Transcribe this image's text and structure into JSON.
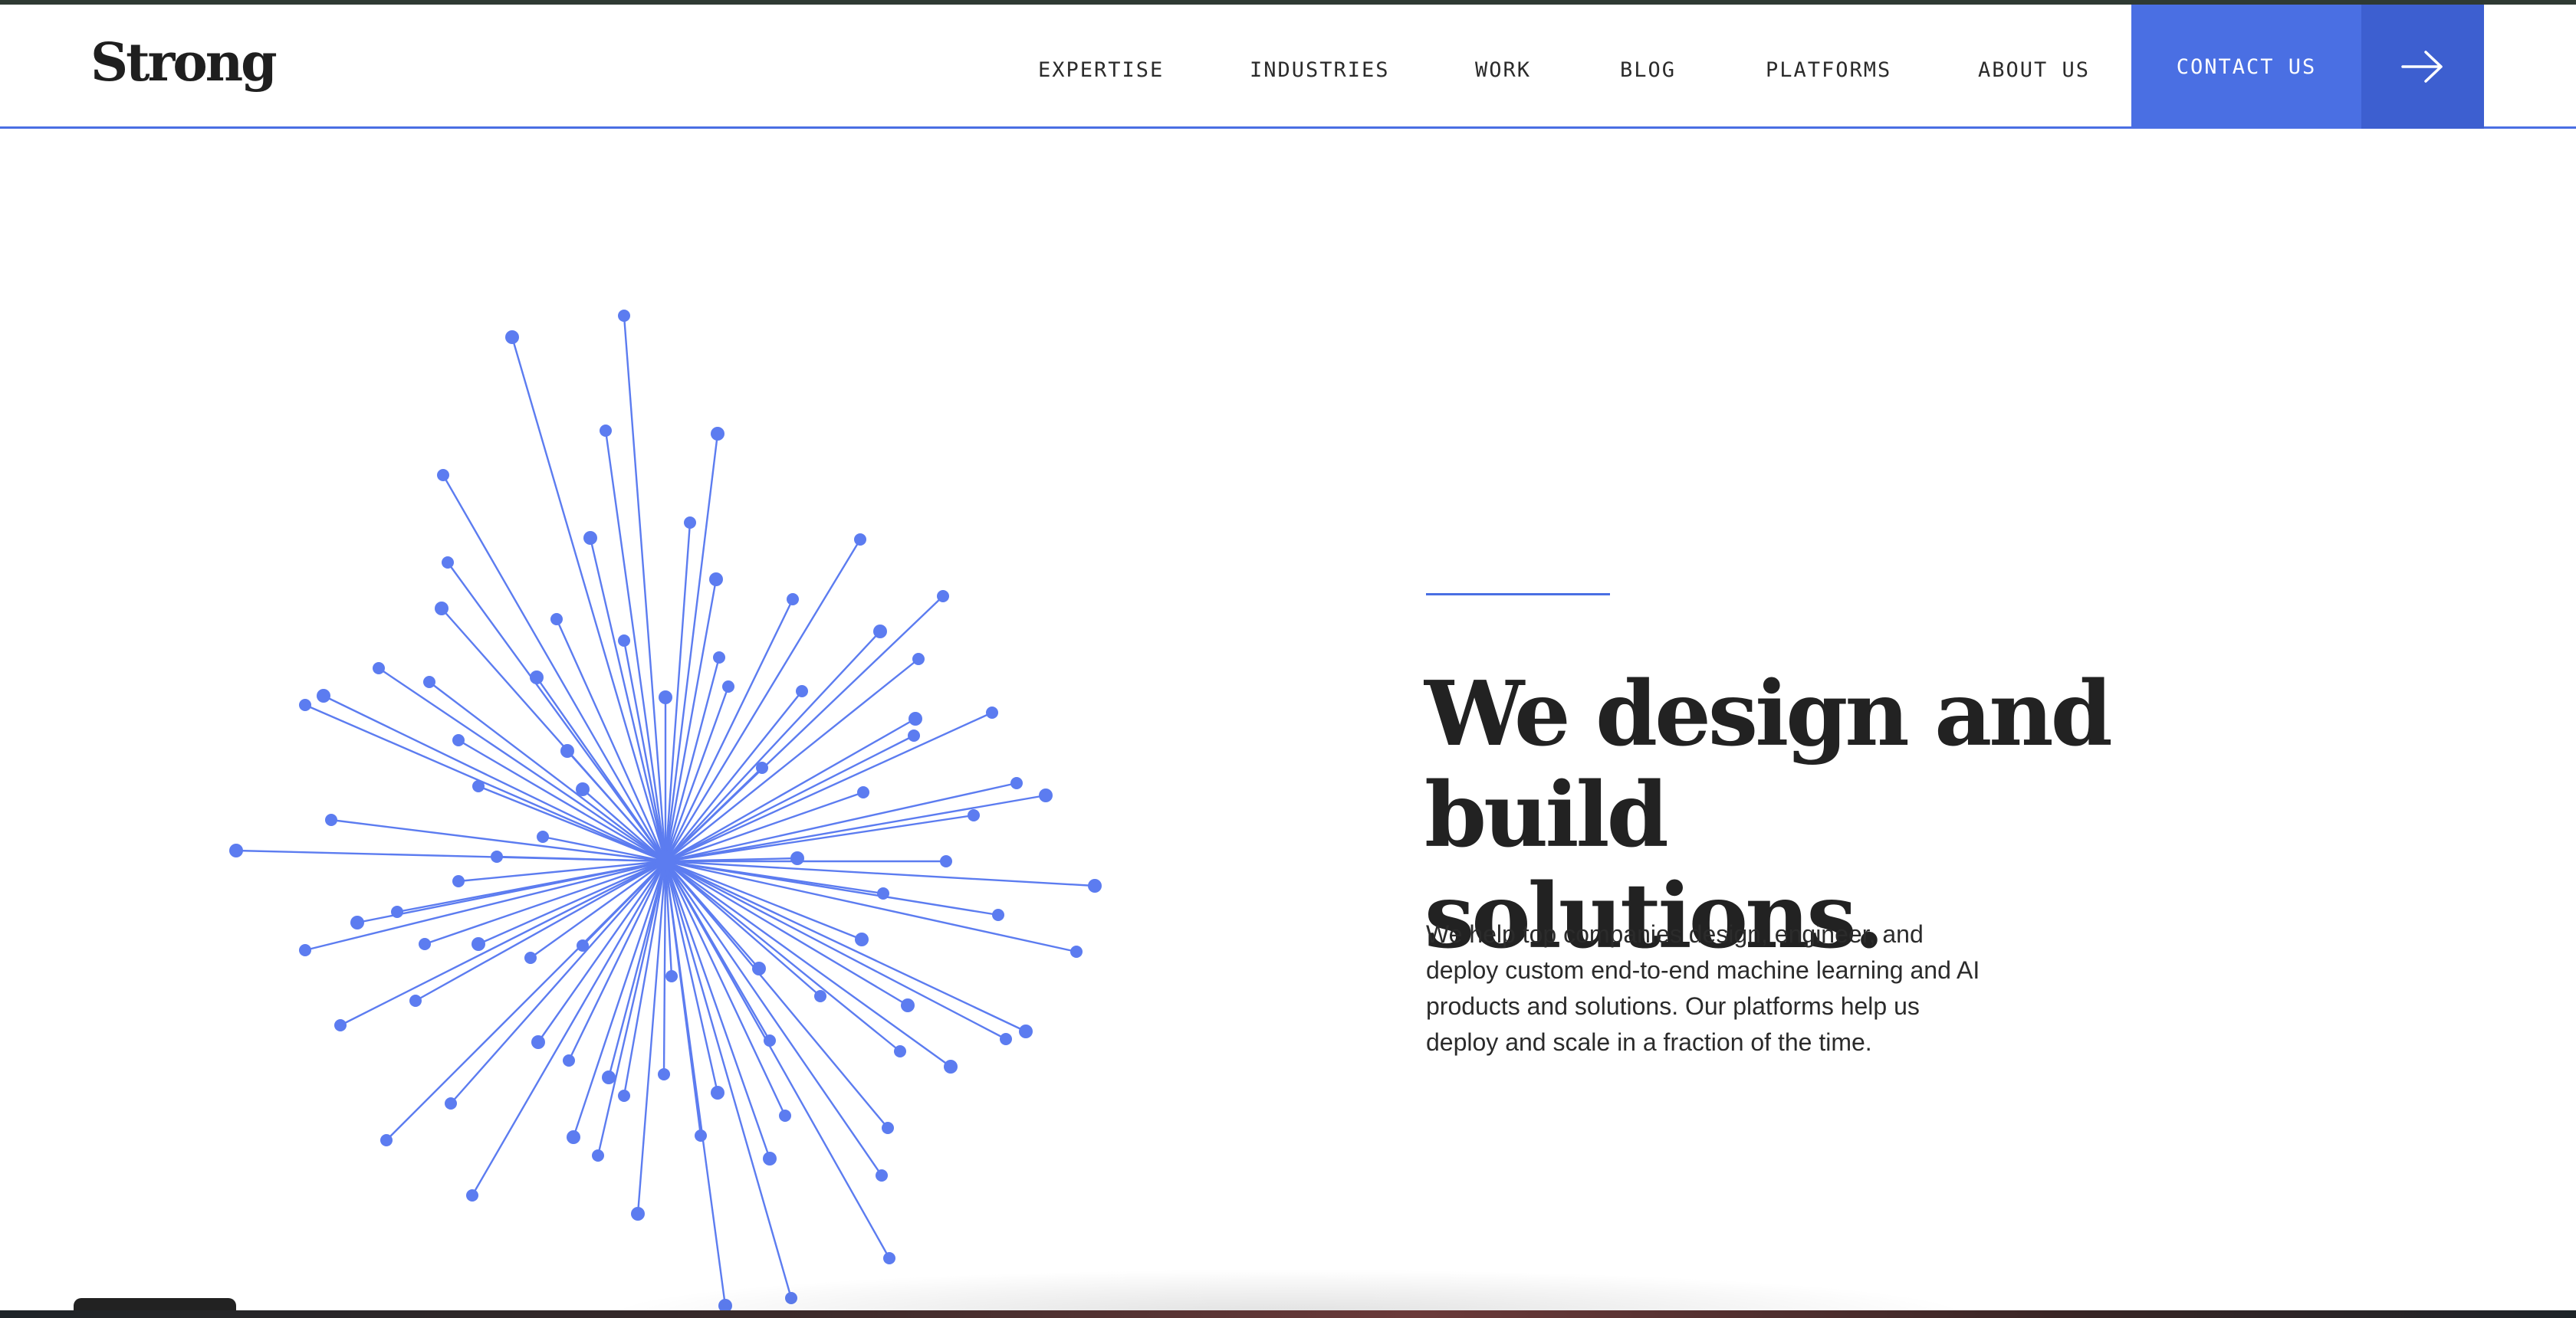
{
  "header": {
    "logo": "Strong",
    "nav": [
      {
        "label": "EXPERTISE"
      },
      {
        "label": "INDUSTRIES"
      },
      {
        "label": "WORK"
      },
      {
        "label": "BLOG"
      },
      {
        "label": "PLATFORMS"
      },
      {
        "label": "ABOUT US"
      }
    ],
    "contact_label": "CONTACT US",
    "arrow_icon": "arrow-right-icon"
  },
  "hero": {
    "headline_line1": "We design and",
    "headline_line2": "build solutions.",
    "body": "We help top companies design, engineer, and deploy custom end-to-end machine learning and AI products and solutions. Our platforms help us deploy and scale in a fraction of the time.",
    "graphic": "network-burst-illustration"
  },
  "colors": {
    "accent": "#4a6fe3",
    "accent_dark": "#3d5fd0",
    "burst": "#5c7cf0",
    "text": "#222222"
  }
}
